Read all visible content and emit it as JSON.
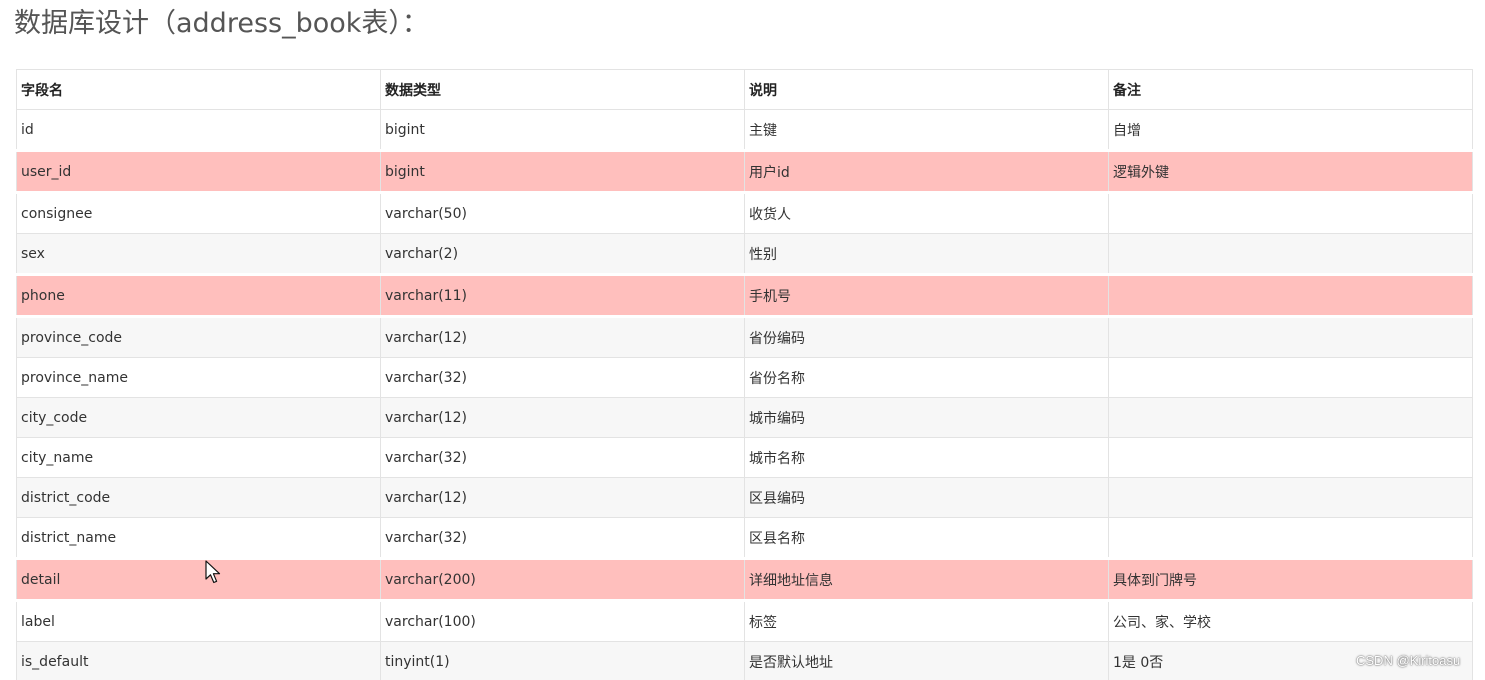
{
  "title": "数据库设计（address_book表）：",
  "table": {
    "headers": [
      "字段名",
      "数据类型",
      "说明",
      "备注"
    ],
    "rows": [
      {
        "field": "id",
        "type": "bigint",
        "desc": "主键",
        "note": "自增",
        "highlight": false
      },
      {
        "field": "user_id",
        "type": "bigint",
        "desc": "用户id",
        "note": "逻辑外键",
        "highlight": true
      },
      {
        "field": "consignee",
        "type": "varchar(50)",
        "desc": "收货人",
        "note": "",
        "highlight": false
      },
      {
        "field": "sex",
        "type": "varchar(2)",
        "desc": "性别",
        "note": "",
        "highlight": false
      },
      {
        "field": "phone",
        "type": "varchar(11)",
        "desc": "手机号",
        "note": "",
        "highlight": true
      },
      {
        "field": "province_code",
        "type": "varchar(12)",
        "desc": "省份编码",
        "note": "",
        "highlight": false
      },
      {
        "field": "province_name",
        "type": "varchar(32)",
        "desc": "省份名称",
        "note": "",
        "highlight": false
      },
      {
        "field": "city_code",
        "type": "varchar(12)",
        "desc": "城市编码",
        "note": "",
        "highlight": false
      },
      {
        "field": "city_name",
        "type": "varchar(32)",
        "desc": "城市名称",
        "note": "",
        "highlight": false
      },
      {
        "field": "district_code",
        "type": "varchar(12)",
        "desc": "区县编码",
        "note": "",
        "highlight": false
      },
      {
        "field": "district_name",
        "type": "varchar(32)",
        "desc": "区县名称",
        "note": "",
        "highlight": false
      },
      {
        "field": "detail",
        "type": "varchar(200)",
        "desc": "详细地址信息",
        "note": "具体到门牌号",
        "highlight": true
      },
      {
        "field": "label",
        "type": "varchar(100)",
        "desc": "标签",
        "note": "公司、家、学校",
        "highlight": false
      },
      {
        "field": "is_default",
        "type": "tinyint(1)",
        "desc": "是否默认地址",
        "note": "1是 0否",
        "highlight": false
      }
    ]
  },
  "colors": {
    "highlight_row": "#ffbfbd",
    "striped_row": "#f7f7f7",
    "border": "#e3e3e3"
  },
  "watermark": "CSDN @Kiritoasu",
  "cursor_icon": "mouse-pointer-icon"
}
